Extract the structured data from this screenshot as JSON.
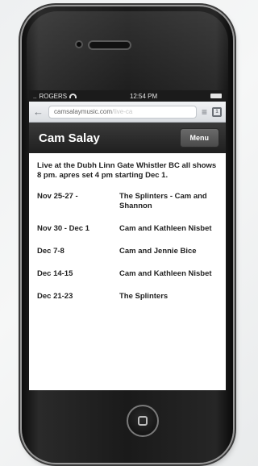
{
  "status": {
    "carrier": "ROGERS",
    "time": "12:54 PM"
  },
  "browser": {
    "url_main": "camsalaymusic.com",
    "url_faded": "/live-ca"
  },
  "site": {
    "title": "Cam Salay",
    "menu_label": "Menu"
  },
  "content": {
    "intro": "Live at  the Dubh Linn Gate   Whistler BC   all shows 8 pm.    apres set 4 pm starting Dec 1.",
    "shows": [
      {
        "date": "Nov 25-27 -",
        "who": "The Splinters - Cam and Shannon"
      },
      {
        "date": "Nov 30 - Dec 1",
        "who": "Cam and Kathleen Nisbet"
      },
      {
        "date": "Dec 7-8",
        "who": "Cam and Jennie Bice"
      },
      {
        "date": "Dec 14-15",
        "who": "Cam and Kathleen Nisbet"
      },
      {
        "date": "Dec 21-23",
        "who": "The Splinters"
      }
    ]
  }
}
